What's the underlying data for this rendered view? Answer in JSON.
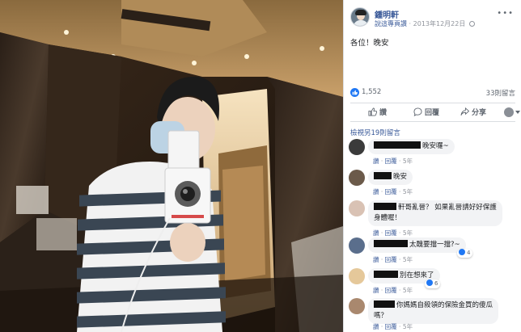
{
  "post": {
    "author": "鍾明軒",
    "meta_link": "說這專頁讚",
    "date": "2013年12月22日",
    "text": "各位！晚安",
    "reaction_count": "1,552",
    "comment_count": "33則留言",
    "more": "•••"
  },
  "actions": {
    "like": "讚",
    "comment": "回覆",
    "share": "分享"
  },
  "comments_section": {
    "view_previous": "檢視另19則留言",
    "items": [
      {
        "text": "晚安囉~",
        "like_label": "讚",
        "reply_label": "回覆",
        "age": "5年",
        "reactions": ""
      },
      {
        "text": "晚安",
        "like_label": "讚",
        "reply_label": "回覆",
        "age": "5年",
        "reactions": ""
      },
      {
        "text": "軒哥亂晉？ 如果亂晉請好好保護身體喔！",
        "line1": "軒哥亂晉？ 如果亂晉請好好保護",
        "line2": "身體喔！",
        "like_label": "讚",
        "reply_label": "回覆",
        "age": "5年",
        "reactions": ""
      },
      {
        "text": "太醜要擋一擋?~",
        "like_label": "讚",
        "reply_label": "回覆",
        "age": "5年",
        "reactions": "4"
      },
      {
        "text": "別在想來了",
        "like_label": "讚",
        "reply_label": "回覆",
        "age": "5年",
        "reactions": "6"
      },
      {
        "text": "你媽媽自殺領的保險金買的傻瓜嗎？",
        "line1": "你媽媽自殺領的保險金買的傻瓜",
        "line2": "嗎？",
        "like_label": "讚",
        "reply_label": "回覆",
        "age": "5年",
        "reactions": ""
      }
    ]
  },
  "colors": {
    "link_blue": "#385898",
    "like_blue": "#2078f4",
    "bubble_gray": "#f2f3f5",
    "muted": "#90949c"
  }
}
